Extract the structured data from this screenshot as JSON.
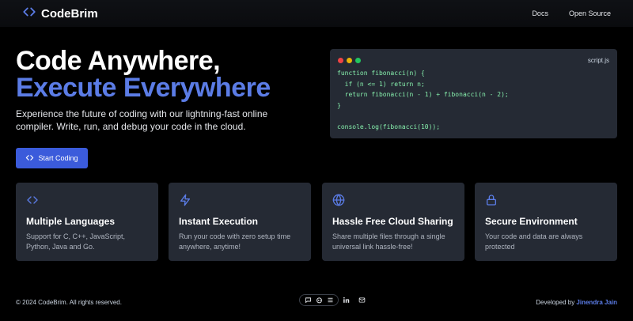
{
  "brand": {
    "name": "CodeBrim",
    "icon": "code-icon"
  },
  "nav": {
    "docs": "Docs",
    "open_source": "Open Source"
  },
  "hero": {
    "title_line1": "Code Anywhere,",
    "title_line2": "Execute Everywhere",
    "description": "Experience the future of coding with our lightning-fast online compiler. Write, run, and debug your code in the cloud.",
    "cta_label": "Start Coding"
  },
  "editor": {
    "filename": "script.js",
    "code": "function fibonacci(n) {\n  if (n <= 1) return n;\n  return fibonacci(n - 1) + fibonacci(n - 2);\n}\n\nconsole.log(fibonacci(10));",
    "dot_colors": [
      "#ef4444",
      "#eab308",
      "#22c55e"
    ]
  },
  "features": [
    {
      "icon": "code-icon",
      "title": "Multiple Languages",
      "desc": "Support for C, C++, JavaScript, Python, Java and Go."
    },
    {
      "icon": "lightning-icon",
      "title": "Instant Execution",
      "desc": "Run your code with zero setup time anywhere, anytime!"
    },
    {
      "icon": "globe-icon",
      "title": "Hassle Free Cloud Sharing",
      "desc": "Share multiple files through a single universal link hassle-free!"
    },
    {
      "icon": "lock-icon",
      "title": "Secure Environment",
      "desc": "Your code and data are always protected"
    }
  ],
  "footer": {
    "copyright": "© 2024 CodeBrim. All rights reserved.",
    "developed_by": "Developed by",
    "developer": "Jinendra Jain"
  },
  "colors": {
    "accent": "#5b7ce6",
    "button": "#3b5bdb",
    "card": "#252a34",
    "code": "#86efac"
  }
}
